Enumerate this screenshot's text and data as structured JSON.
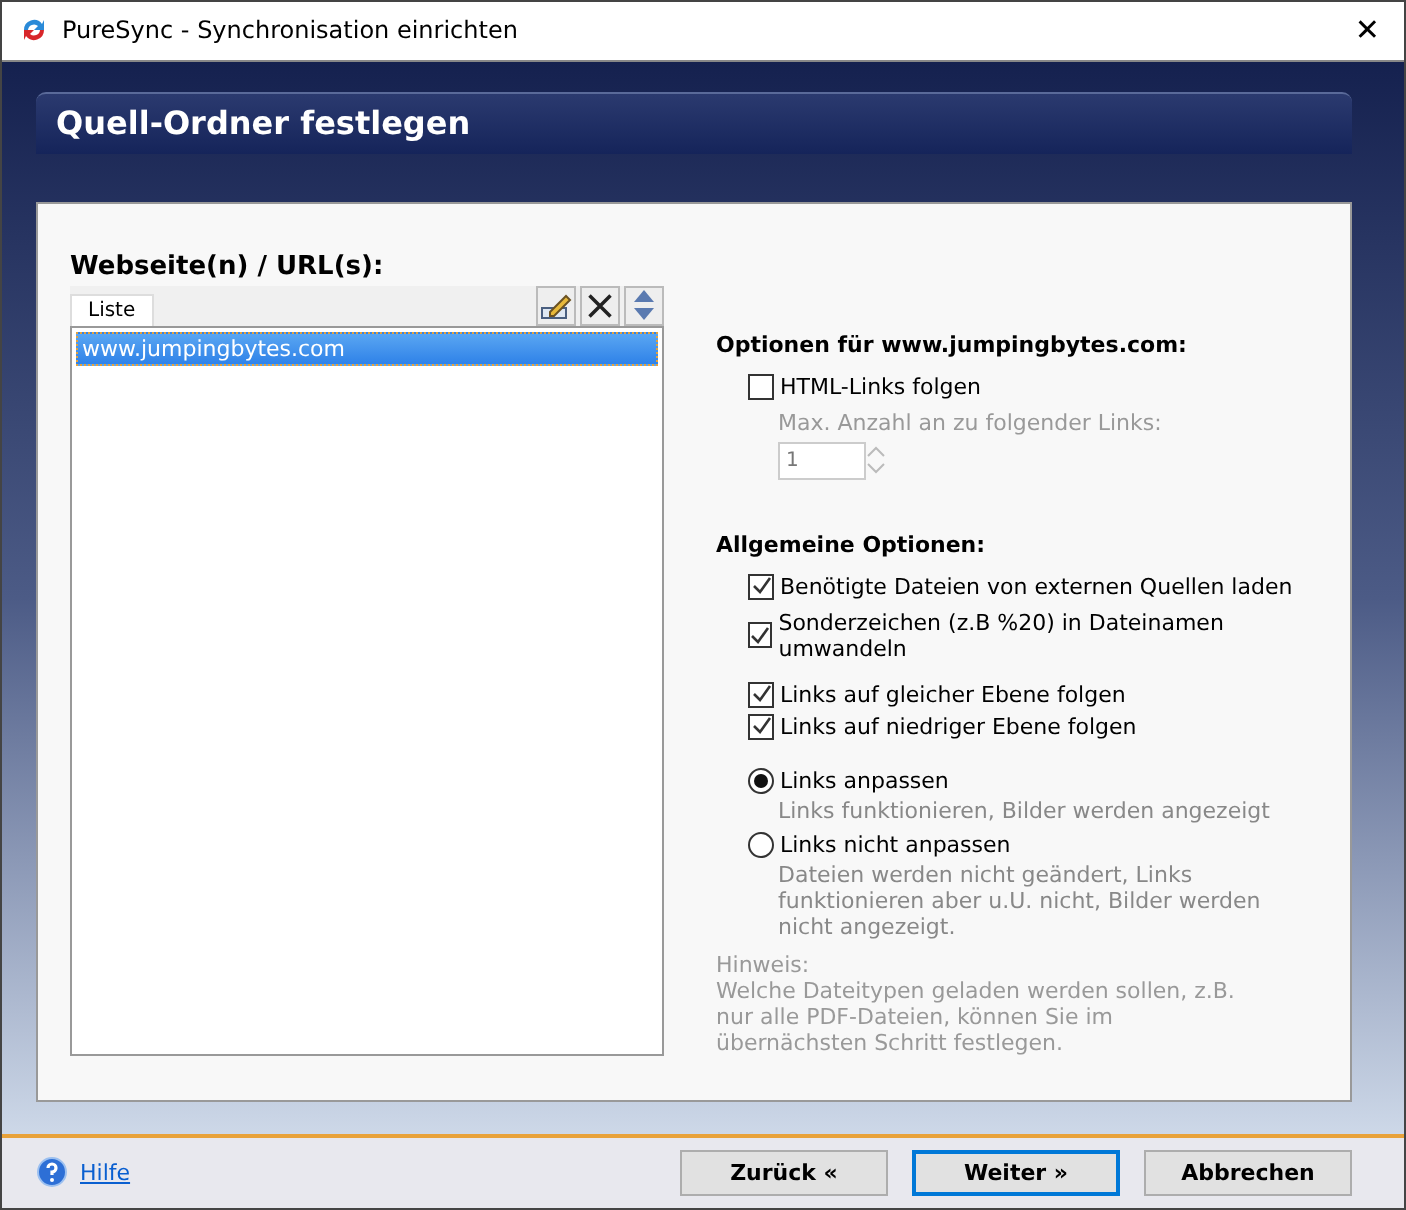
{
  "window": {
    "title": "PureSync - Synchronisation einrichten",
    "close": "✕"
  },
  "header": "Quell-Ordner festlegen",
  "list_panel": {
    "label": "Webseite(n) / URL(s):",
    "tabs": [
      {
        "label": "Liste",
        "selected": true
      }
    ],
    "items": [
      {
        "text": "www.jumpingbytes.com",
        "selected": true
      }
    ]
  },
  "site_options": {
    "heading": "Optionen für www.jumpingbytes.com:",
    "follow_links": {
      "label": "HTML-Links folgen",
      "checked": false
    },
    "max_links": {
      "label": "Max. Anzahl an zu folgender Links:",
      "value": "1",
      "disabled": true
    }
  },
  "general_options": {
    "heading": "Allgemeine Optionen:",
    "checkboxes": [
      {
        "label": "Benötigte Dateien von externen Quellen laden",
        "checked": true
      },
      {
        "label": "Sonderzeichen (z.B %20) in Dateinamen umwandeln",
        "checked": true
      },
      {
        "label": "Links auf gleicher Ebene folgen",
        "checked": true
      },
      {
        "label": "Links auf niedriger Ebene folgen",
        "checked": true
      }
    ],
    "radios": [
      {
        "label": "Links anpassen",
        "description": "Links funktionieren, Bilder werden angezeigt",
        "selected": true
      },
      {
        "label": "Links nicht anpassen",
        "description": "Dateien werden nicht geändert, Links funktionieren aber u.U. nicht, Bilder werden nicht angezeigt.",
        "selected": false
      }
    ]
  },
  "hint": {
    "title": "Hinweis:",
    "text": "Welche Dateitypen geladen werden sollen, z.B. nur alle PDF-Dateien, können Sie im übernächsten Schritt festlegen."
  },
  "footer": {
    "help": "Hilfe",
    "buttons": [
      {
        "label": "Zurück «",
        "default": false
      },
      {
        "label": "Weiter »",
        "default": true
      },
      {
        "label": "Abbrechen",
        "default": false
      }
    ]
  }
}
